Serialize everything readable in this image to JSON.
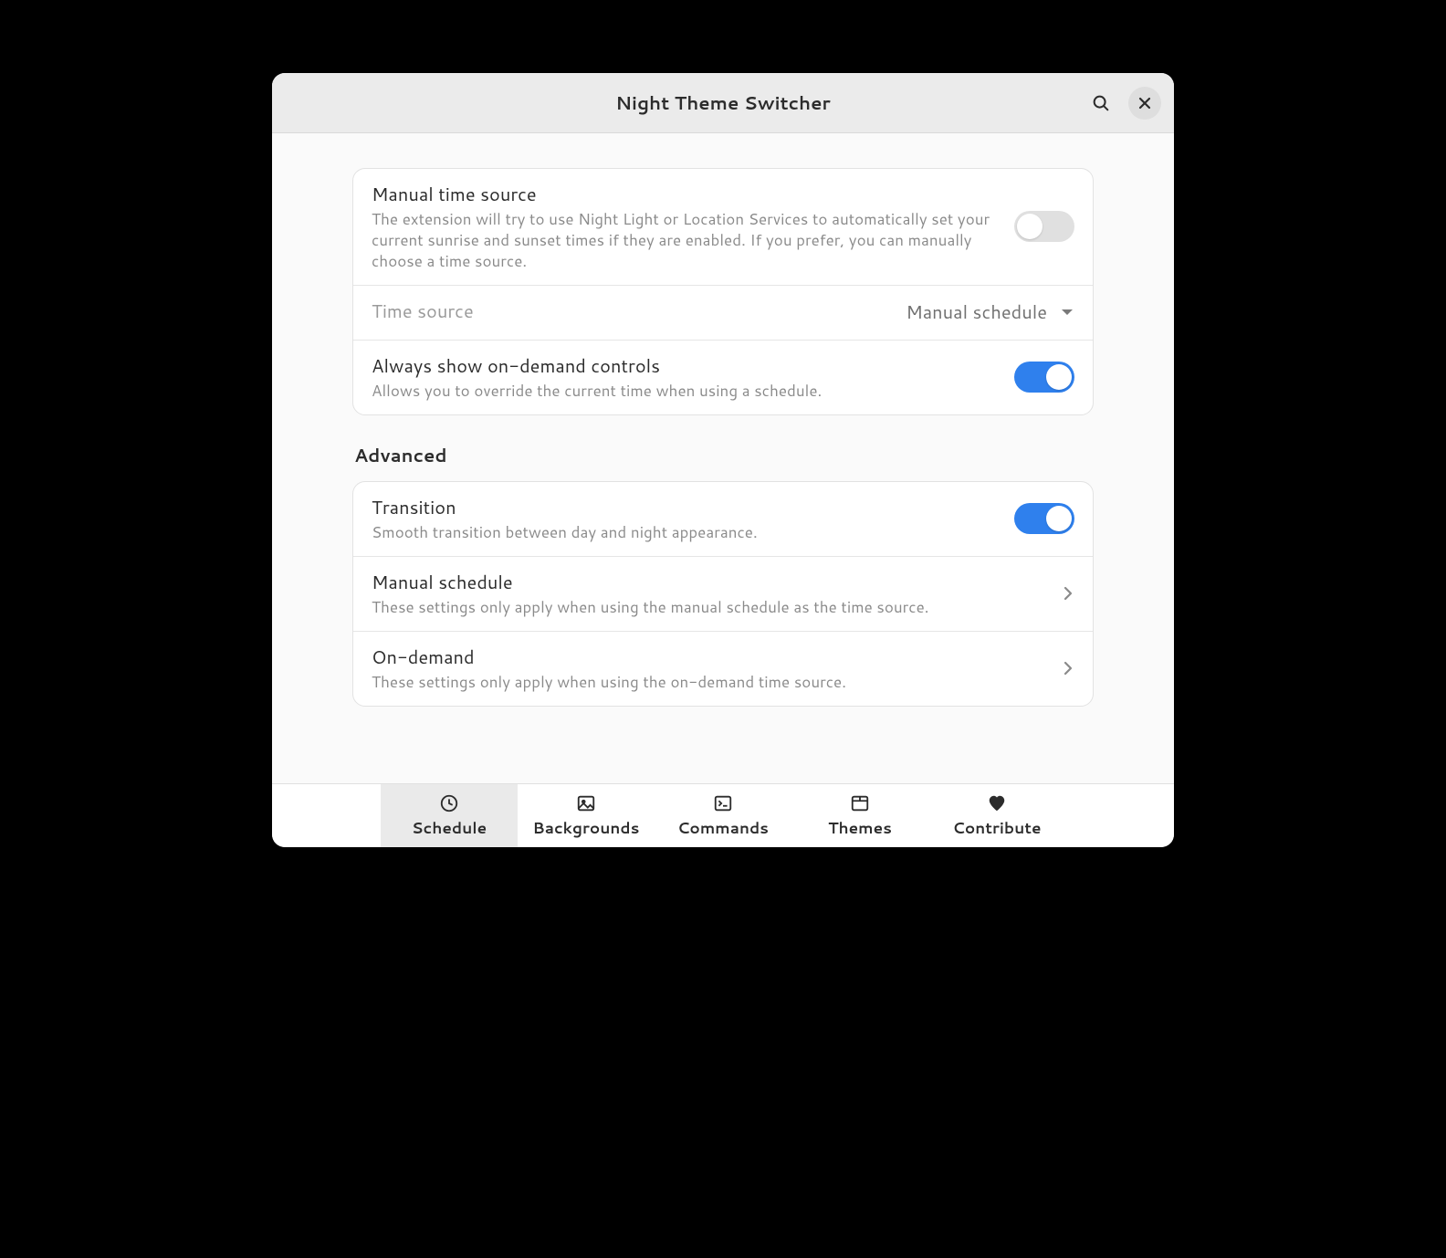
{
  "header": {
    "title": "Night Theme Switcher"
  },
  "group1": {
    "manual_time_source": {
      "title": "Manual time source",
      "subtitle": "The extension will try to use Night Light or Location Services to automatically set your current sunrise and sunset times if they are enabled. If you prefer, you can manually choose a time source.",
      "enabled": false
    },
    "time_source": {
      "title": "Time source",
      "value": "Manual schedule"
    },
    "always_show": {
      "title": "Always show on-demand controls",
      "subtitle": "Allows you to override the current time when using a schedule.",
      "enabled": true
    }
  },
  "advanced": {
    "heading": "Advanced",
    "transition": {
      "title": "Transition",
      "subtitle": "Smooth transition between day and night appearance.",
      "enabled": true
    },
    "manual_schedule": {
      "title": "Manual schedule",
      "subtitle": "These settings only apply when using the manual schedule as the time source."
    },
    "on_demand": {
      "title": "On-demand",
      "subtitle": "These settings only apply when using the on-demand time source."
    }
  },
  "tabs": {
    "schedule": "Schedule",
    "backgrounds": "Backgrounds",
    "commands": "Commands",
    "themes": "Themes",
    "contribute": "Contribute"
  }
}
